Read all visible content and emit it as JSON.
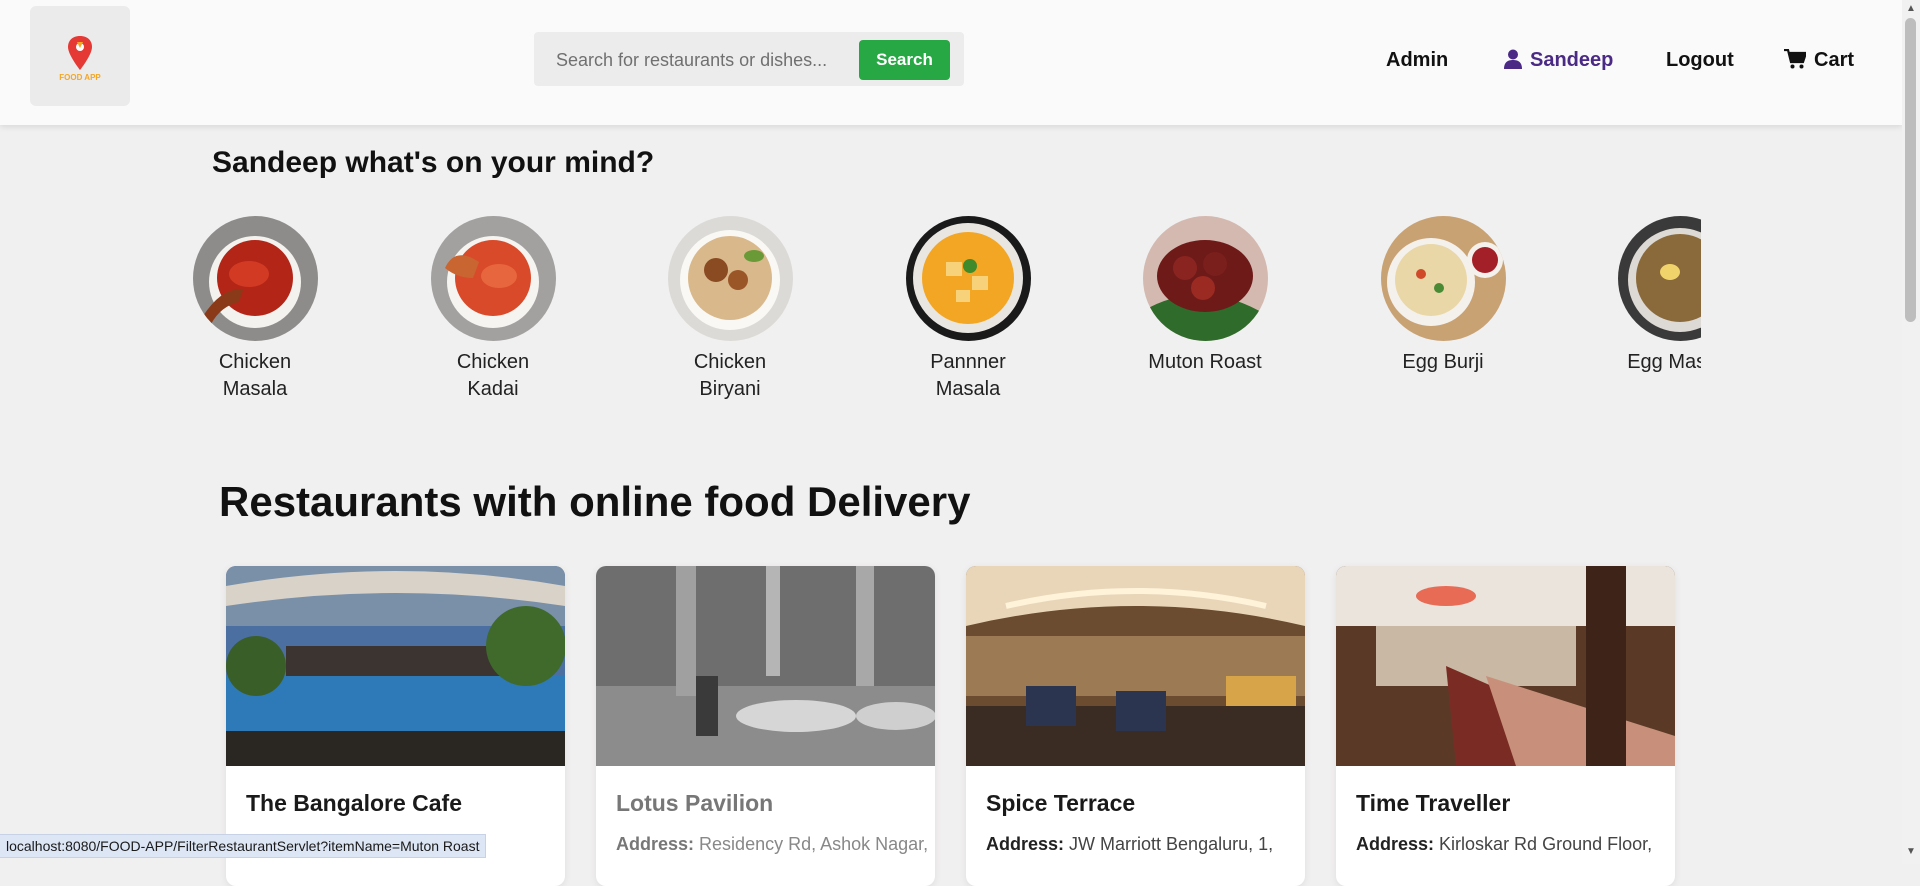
{
  "header": {
    "logo_text": "FOOD APP",
    "search": {
      "placeholder": "Search for restaurants or dishes...",
      "button_label": "Search"
    },
    "nav": {
      "admin": "Admin",
      "user": "Sandeep",
      "logout": "Logout",
      "cart": "Cart"
    }
  },
  "mind": {
    "title": "Sandeep what's on your mind?",
    "dishes": [
      {
        "name": "Chicken Masala",
        "icon": "chicken-masala-photo"
      },
      {
        "name": "Chicken Kadai",
        "icon": "chicken-kadai-photo"
      },
      {
        "name": "Chicken Biryani",
        "icon": "chicken-biryani-photo"
      },
      {
        "name": "Pannner Masala",
        "icon": "paneer-masala-photo"
      },
      {
        "name": "Muton Roast",
        "icon": "mutton-roast-photo"
      },
      {
        "name": "Egg Burji",
        "icon": "egg-burji-photo"
      },
      {
        "name": "Egg Masala",
        "icon": "egg-masala-photo"
      }
    ]
  },
  "restaurants": {
    "title": "Restaurants with online food Delivery",
    "address_label": "Address:",
    "items": [
      {
        "name": "The Bangalore Cafe",
        "address": ""
      },
      {
        "name": "Lotus Pavilion",
        "address": "Residency Rd, Ashok Nagar,"
      },
      {
        "name": "Spice Terrace",
        "address": "JW Marriott Bengaluru, 1,"
      },
      {
        "name": "Time Traveller",
        "address": "Kirloskar Rd Ground Floor,"
      }
    ]
  },
  "status_bar": {
    "url": "localhost:8080/FOOD-APP/FilterRestaurantServlet?itemName=Muton Roast"
  },
  "colors": {
    "accent_green": "#28a745",
    "user_purple": "#4b2a86",
    "logo_red": "#e53935"
  }
}
